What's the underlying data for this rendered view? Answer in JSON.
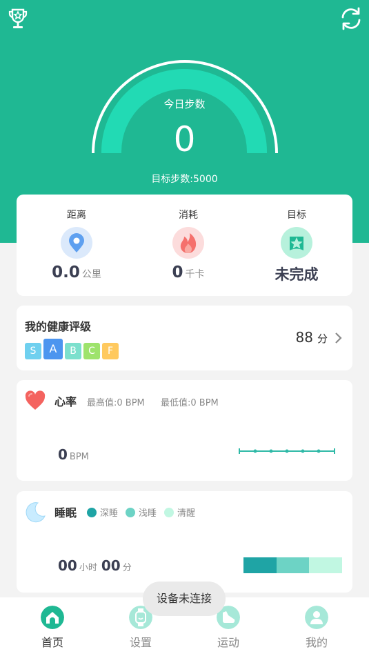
{
  "colors": {
    "header": "#1fb893",
    "gauge": "#22dab4",
    "deep": "#1fa4a5",
    "light": "#6dd3c5",
    "awake": "#c1f7e2"
  },
  "header": {
    "today_label": "今日步数",
    "today_value": "0",
    "goal_text": "目标步数:5000"
  },
  "stats": [
    {
      "label": "距离",
      "value": "0.0",
      "unit": "公里",
      "icon": "location-pin-icon"
    },
    {
      "label": "消耗",
      "value": "0",
      "unit": "千卡",
      "icon": "flame-icon"
    },
    {
      "label": "目标",
      "value": "未完成",
      "unit": "",
      "icon": "star-badge-icon"
    }
  ],
  "health": {
    "title": "我的健康评级",
    "grades": [
      "S",
      "A",
      "B",
      "C",
      "F"
    ],
    "selected_grade": "A",
    "score": "88",
    "score_unit": "分"
  },
  "heart_rate": {
    "title": "心率",
    "max": "最高值:0 BPM",
    "min": "最低值:0 BPM",
    "value": "0",
    "unit": "BPM"
  },
  "sleep": {
    "title": "睡眠",
    "legend": [
      "深睡",
      "浅睡",
      "清醒"
    ],
    "hours": "00",
    "hours_unit": "小时",
    "minutes": "00",
    "minutes_unit": "分"
  },
  "tabs": [
    {
      "label": "首页",
      "icon": "home-icon",
      "active": true
    },
    {
      "label": "设置",
      "icon": "watch-icon",
      "active": false
    },
    {
      "label": "运动",
      "icon": "shoe-icon",
      "active": false
    },
    {
      "label": "我的",
      "icon": "user-icon",
      "active": false
    }
  ],
  "toast": "设备未连接"
}
